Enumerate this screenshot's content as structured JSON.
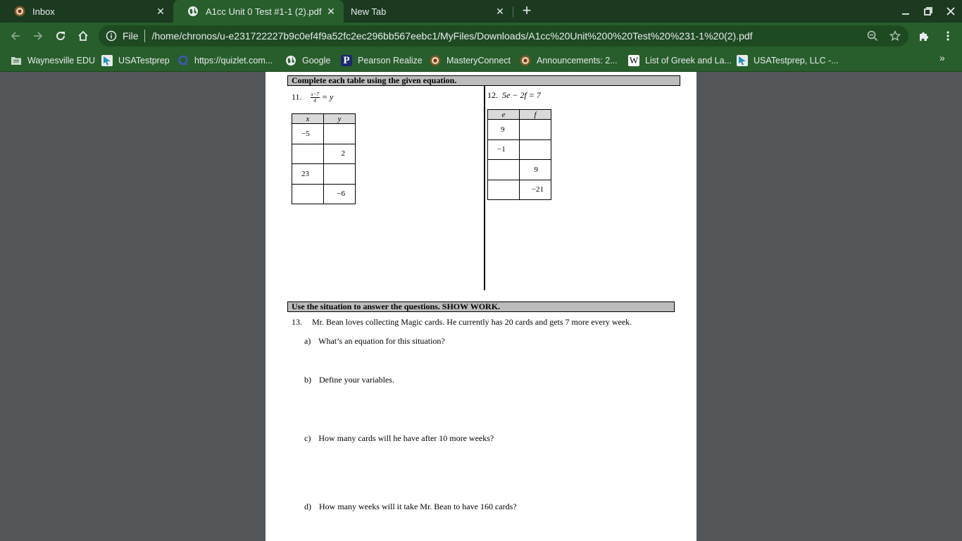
{
  "browser": {
    "tabs": [
      {
        "title": "Inbox",
        "icon": "school-seal-icon",
        "active": false
      },
      {
        "title": "A1cc Unit 0 Test #1-1 (2).pdf",
        "icon": "globe-icon",
        "active": true
      },
      {
        "title": "New Tab",
        "icon": "",
        "active": false
      }
    ],
    "new_tab_label": "+",
    "window_controls": {
      "minimize": "minimize",
      "restore": "restore",
      "close": "close"
    },
    "omnibox": {
      "scheme_label": "File",
      "url": "/home/chronos/u-e231722227b9c0ef4f9a52fc2ec296bb567eebc1/MyFiles/Downloads/A1cc%20Unit%200%20Test%20%231-1%20(2).pdf"
    },
    "bookmarks": [
      {
        "label": "Waynesville EDU",
        "icon": "folder-icon"
      },
      {
        "label": "USATestprep",
        "icon": "usatestprep-icon"
      },
      {
        "label": "https://quizlet.com...",
        "icon": "quizlet-icon"
      },
      {
        "label": "Google",
        "icon": "globe-icon"
      },
      {
        "label": "Pearson Realize",
        "icon": "pearson-icon"
      },
      {
        "label": "MasteryConnect",
        "icon": "school-seal-icon"
      },
      {
        "label": "Announcements: 2...",
        "icon": "school-seal-icon"
      },
      {
        "label": "List of Greek and La...",
        "icon": "wikipedia-icon"
      },
      {
        "label": "USATestprep, LLC -...",
        "icon": "usatestprep-icon"
      }
    ],
    "bookmarks_overflow": "»"
  },
  "colors": {
    "tabstrip": "#1b3a1f",
    "toolbar": "#275e2b",
    "viewer_bg": "#525659",
    "banner_fill": "#bcbcbc"
  },
  "document": {
    "section1_banner": "Complete each table using the given equation.",
    "q11": {
      "number": "11.",
      "equation_numerator": "x−7",
      "equation_denominator": "4",
      "equation_rhs": "= y",
      "headers": [
        "x",
        "y"
      ],
      "rows": [
        [
          "−5",
          ""
        ],
        [
          "",
          "2"
        ],
        [
          "23",
          ""
        ],
        [
          "",
          "−6"
        ]
      ]
    },
    "q12": {
      "number": "12.",
      "equation": "5e − 2f = 7",
      "headers": [
        "e",
        "f"
      ],
      "rows": [
        [
          "9",
          ""
        ],
        [
          "−1",
          ""
        ],
        [
          "",
          "9"
        ],
        [
          "",
          "−21"
        ]
      ]
    },
    "section2_banner": "Use the situation to answer the questions.   SHOW WORK.",
    "q13": {
      "number": "13.",
      "prompt": "Mr. Bean loves collecting Magic cards.  He currently has 20 cards and gets 7 more every week.",
      "parts": [
        {
          "label": "a)",
          "text": "What’s an equation for this situation?"
        },
        {
          "label": "b)",
          "text": "Define your variables."
        },
        {
          "label": "c)",
          "text": "How many cards will he have after 10 more weeks?"
        },
        {
          "label": "d)",
          "text": "How many weeks will it take Mr. Bean to have 160 cards?"
        }
      ]
    }
  }
}
